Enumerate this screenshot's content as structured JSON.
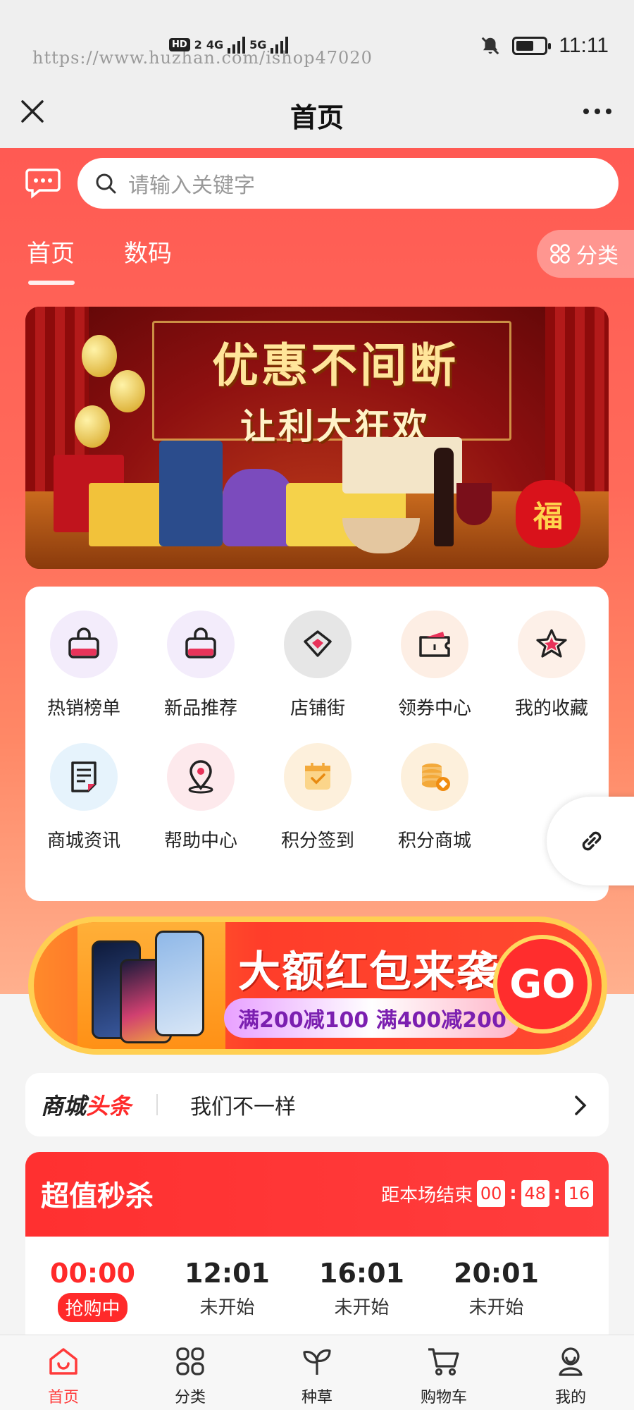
{
  "status": {
    "watermark": "https://www.huzhan.com/ishop47020",
    "hd": "HD",
    "sim": "2",
    "net1": "4G",
    "net2": "5G",
    "time": "11:11"
  },
  "titlebar": {
    "title": "首页"
  },
  "search": {
    "placeholder": "请输入关键字"
  },
  "tabs": [
    {
      "label": "首页",
      "active": true
    },
    {
      "label": "数码",
      "active": false
    }
  ],
  "category_button": "分类",
  "banner": {
    "line1": "优惠不间断",
    "line2": "让利大狂欢",
    "bag_text": "福"
  },
  "menu": [
    {
      "label": "热销榜单",
      "icon": "shopping-bag-icon"
    },
    {
      "label": "新品推荐",
      "icon": "shopping-bag-icon"
    },
    {
      "label": "店铺街",
      "icon": "gem-icon"
    },
    {
      "label": "领券中心",
      "icon": "coupon-icon"
    },
    {
      "label": "我的收藏",
      "icon": "star-icon"
    },
    {
      "label": "商城资讯",
      "icon": "document-icon"
    },
    {
      "label": "帮助中心",
      "icon": "location-pin-icon"
    },
    {
      "label": "积分签到",
      "icon": "calendar-check-icon"
    },
    {
      "label": "积分商城",
      "icon": "coins-icon"
    }
  ],
  "promo": {
    "title": "大额红包来袭",
    "subtitle": "满200减100 满400减200",
    "go": "GO"
  },
  "headline": {
    "label_a": "商城",
    "label_b": "头条",
    "text": "我们不一样"
  },
  "flash_sale": {
    "title": "超值秒杀",
    "countdown_label": "距本场结束",
    "hours": "00",
    "minutes": "48",
    "seconds": "16",
    "slots": [
      {
        "time": "00:00",
        "status": "抢购中",
        "active": true
      },
      {
        "time": "12:01",
        "status": "未开始",
        "active": false
      },
      {
        "time": "16:01",
        "status": "未开始",
        "active": false
      },
      {
        "time": "20:01",
        "status": "未开始",
        "active": false
      }
    ]
  },
  "bottom_nav": [
    {
      "label": "首页",
      "active": true
    },
    {
      "label": "分类",
      "active": false
    },
    {
      "label": "种草",
      "active": false
    },
    {
      "label": "购物车",
      "active": false
    },
    {
      "label": "我的",
      "active": false
    }
  ],
  "colors": {
    "accent": "#ff3a3a",
    "header": "#ff5a53"
  }
}
